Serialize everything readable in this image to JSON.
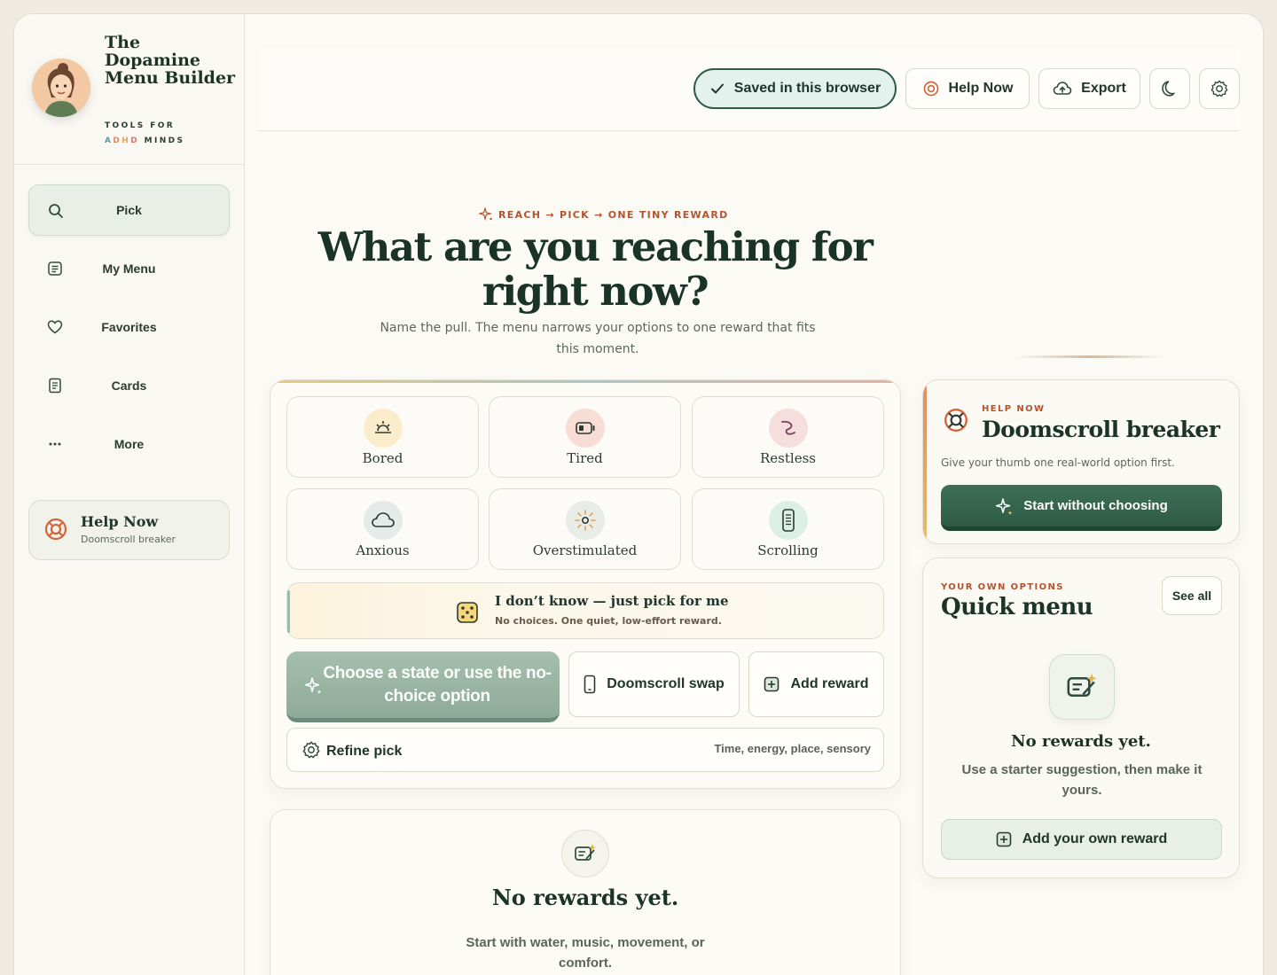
{
  "brand": {
    "title": "The Dopamine Menu Builder",
    "tagline_pre": "TOOLS FOR",
    "tagline_a1": "A",
    "tagline_a2": "D",
    "tagline_a3": "H",
    "tagline_a4": "D",
    "tagline_post": "MINDS"
  },
  "nav": {
    "items": [
      {
        "label": "Pick",
        "icon": "search-icon",
        "active": true
      },
      {
        "label": "My Menu",
        "icon": "menu-list-icon"
      },
      {
        "label": "Favorites",
        "icon": "heart-icon"
      },
      {
        "label": "Cards",
        "icon": "cards-icon"
      },
      {
        "label": "More",
        "icon": "more-dots-icon"
      }
    ],
    "help": {
      "title": "Help Now",
      "subtitle": "Doomscroll breaker",
      "icon": "lifebuoy-icon"
    }
  },
  "topbar": {
    "saved": "Saved in this browser",
    "help": "Help Now",
    "export": "Export",
    "theme_icon": "moon-icon",
    "settings_icon": "gear-icon"
  },
  "hero": {
    "eyebrow": "REACH → PICK → ONE TINY REWARD",
    "title": "What are you reaching for right now?",
    "subtitle": "Name the pull. The menu narrows your options to one reward that fits this moment."
  },
  "picker": {
    "states": [
      {
        "label": "Bored",
        "icon": "sunrise-icon"
      },
      {
        "label": "Tired",
        "icon": "battery-low-icon"
      },
      {
        "label": "Restless",
        "icon": "squiggle-icon"
      },
      {
        "label": "Anxious",
        "icon": "cloud-icon"
      },
      {
        "label": "Overstimulated",
        "icon": "sun-burst-icon"
      },
      {
        "label": "Scrolling",
        "icon": "phone-icon"
      }
    ],
    "idk_title": "I don’t know — just pick for me",
    "idk_subtitle": "No choices. One quiet, low-effort reward.",
    "choose": "Choose a state or use the no-choice option",
    "doomscroll": "Doomscroll swap",
    "add_reward": "Add reward",
    "refine": "Refine pick",
    "refine_hint": "Time, energy, place, sensory"
  },
  "empty_main": {
    "title": "No rewards yet.",
    "subtitle": "Start with water, music, movement, or comfort."
  },
  "help_now_card": {
    "eyebrow": "HELP NOW",
    "title": "Doomscroll breaker",
    "subtitle": "Give your thumb one real-world option first.",
    "button": "Start without choosing"
  },
  "quick_menu": {
    "eyebrow": "YOUR OWN OPTIONS",
    "title": "Quick menu",
    "see_all": "See all",
    "empty_title": "No rewards yet.",
    "empty_subtitle": "Use a starter suggestion, then make it yours.",
    "add_button": "Add your own reward"
  },
  "colors": {
    "primary": "#2f5a45",
    "accent": "#b4542f",
    "sage": "#8eaa99",
    "background": "#fcfaf5"
  }
}
